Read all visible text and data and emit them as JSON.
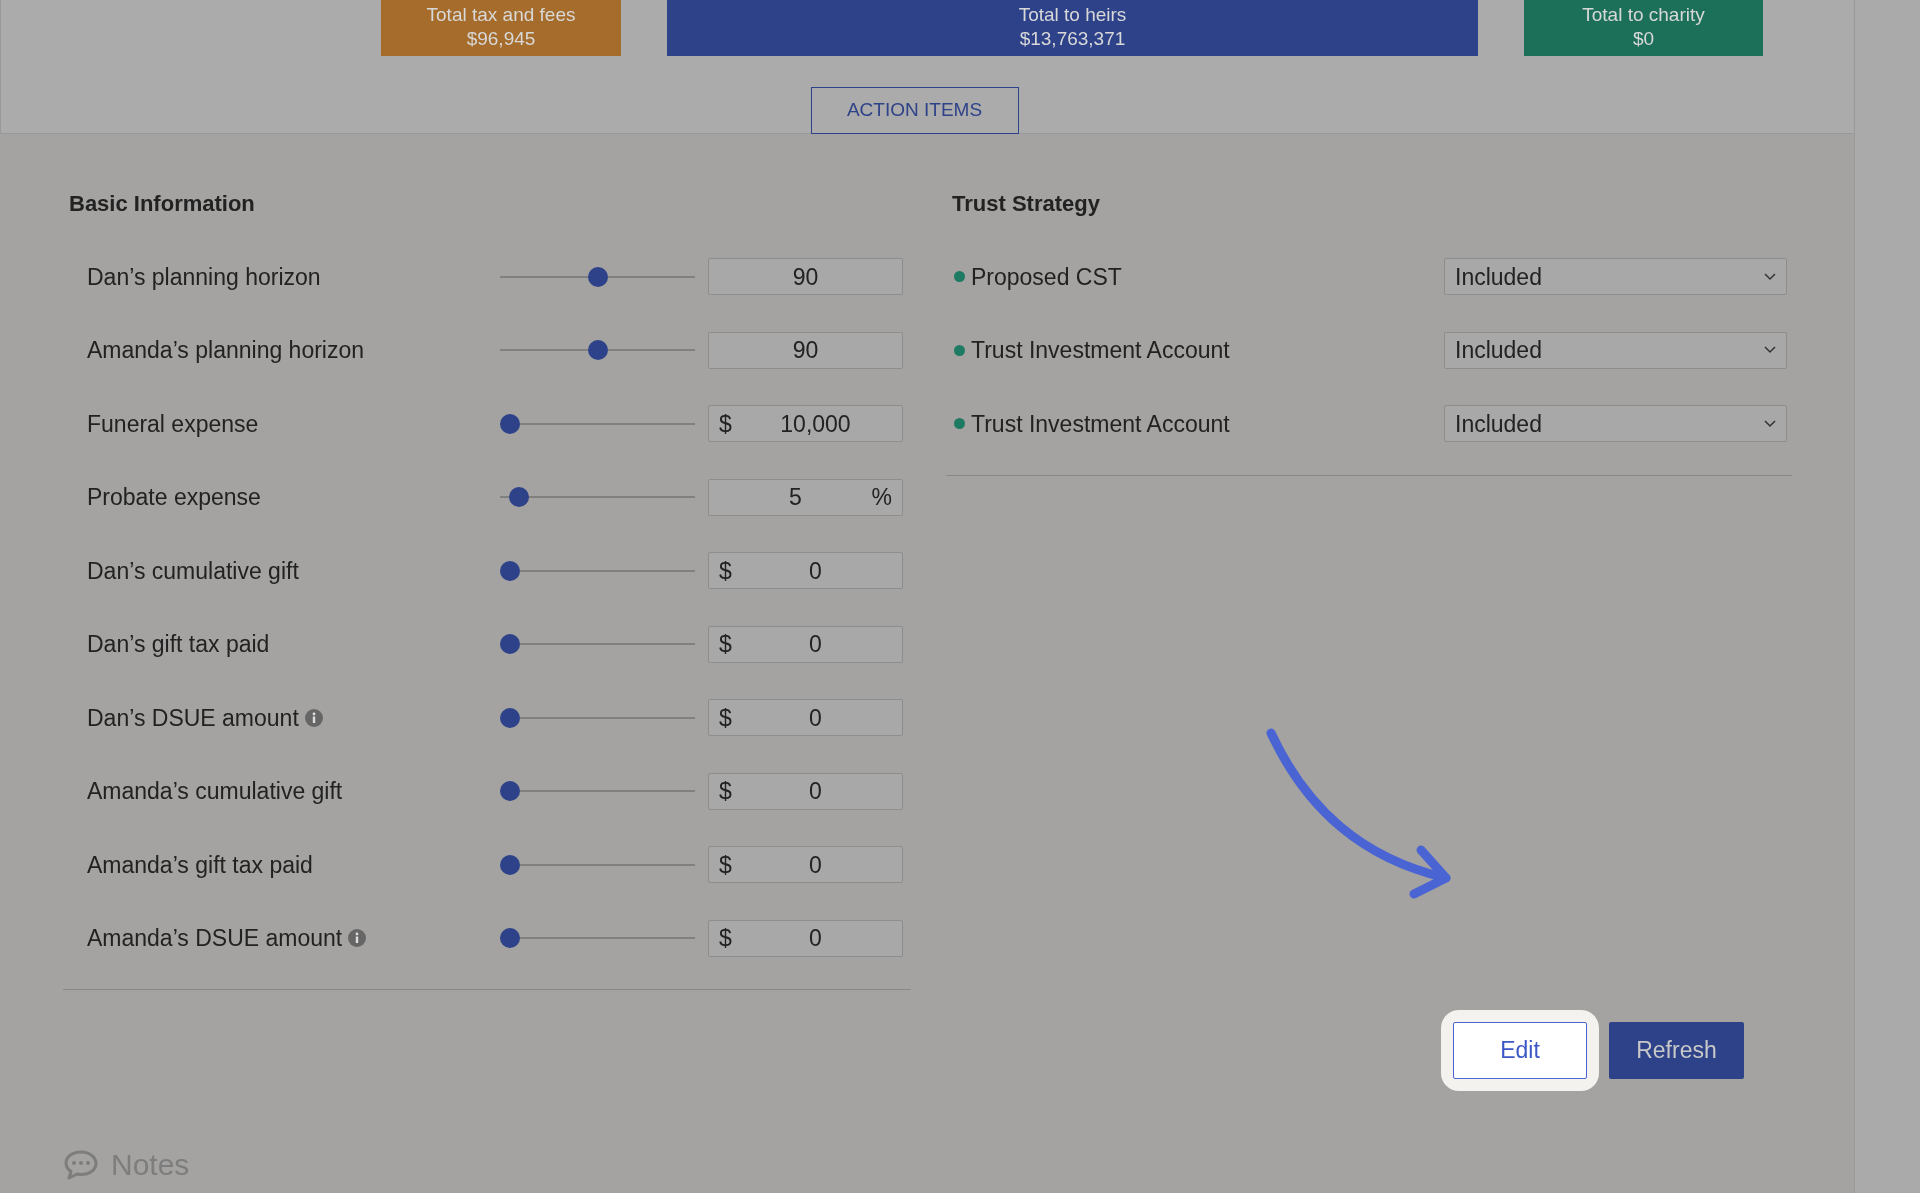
{
  "summary": [
    {
      "label": "Total tax and fees",
      "value": "$96,945",
      "color": "#a56c2b"
    },
    {
      "label": "Total to heirs",
      "value": "$13,763,371",
      "color": "#2e428a"
    },
    {
      "label": "Total to charity",
      "value": "$0",
      "color": "#1c7059"
    }
  ],
  "action_items": "ACTION ITEMS",
  "basic_information": {
    "title": "Basic Information",
    "rows": [
      {
        "label": "Dan’s planning horizon",
        "info": false,
        "level": 0.5,
        "value": "90"
      },
      {
        "label": "Amanda’s planning horizon",
        "info": false,
        "level": 0.5,
        "value": "90"
      },
      {
        "label": "Funeral expense",
        "info": false,
        "level": 0,
        "prefix": "$",
        "value": "10,000"
      },
      {
        "label": "Probate expense",
        "info": false,
        "level": 0.05,
        "value": "5",
        "suffix": "%"
      },
      {
        "label": "Dan’s cumulative gift",
        "info": false,
        "level": 0,
        "prefix": "$",
        "value": "0"
      },
      {
        "label": "Dan’s gift tax paid",
        "info": false,
        "level": 0,
        "prefix": "$",
        "value": "0"
      },
      {
        "label": "Dan’s DSUE amount",
        "info": true,
        "level": 0,
        "prefix": "$",
        "value": "0"
      },
      {
        "label": "Amanda’s cumulative gift",
        "info": false,
        "level": 0,
        "prefix": "$",
        "value": "0"
      },
      {
        "label": "Amanda’s gift tax paid",
        "info": false,
        "level": 0,
        "prefix": "$",
        "value": "0"
      },
      {
        "label": "Amanda’s DSUE amount",
        "info": true,
        "level": 0,
        "prefix": "$",
        "value": "0"
      }
    ]
  },
  "trust_strategy": {
    "title": "Trust Strategy",
    "rows": [
      {
        "label": "Proposed CST",
        "color": "#1e7a62",
        "value": "Included"
      },
      {
        "label": "Trust Investment Account",
        "color": "#1e7a62",
        "value": "Included"
      },
      {
        "label": "Trust Investment Account",
        "color": "#1e7a62",
        "value": "Included"
      }
    ]
  },
  "buttons": [
    {
      "label": "Edit",
      "kind": "outline",
      "highlighted": true
    },
    {
      "label": "Refresh",
      "kind": "primary",
      "highlighted": false
    }
  ],
  "notes": "Notes"
}
